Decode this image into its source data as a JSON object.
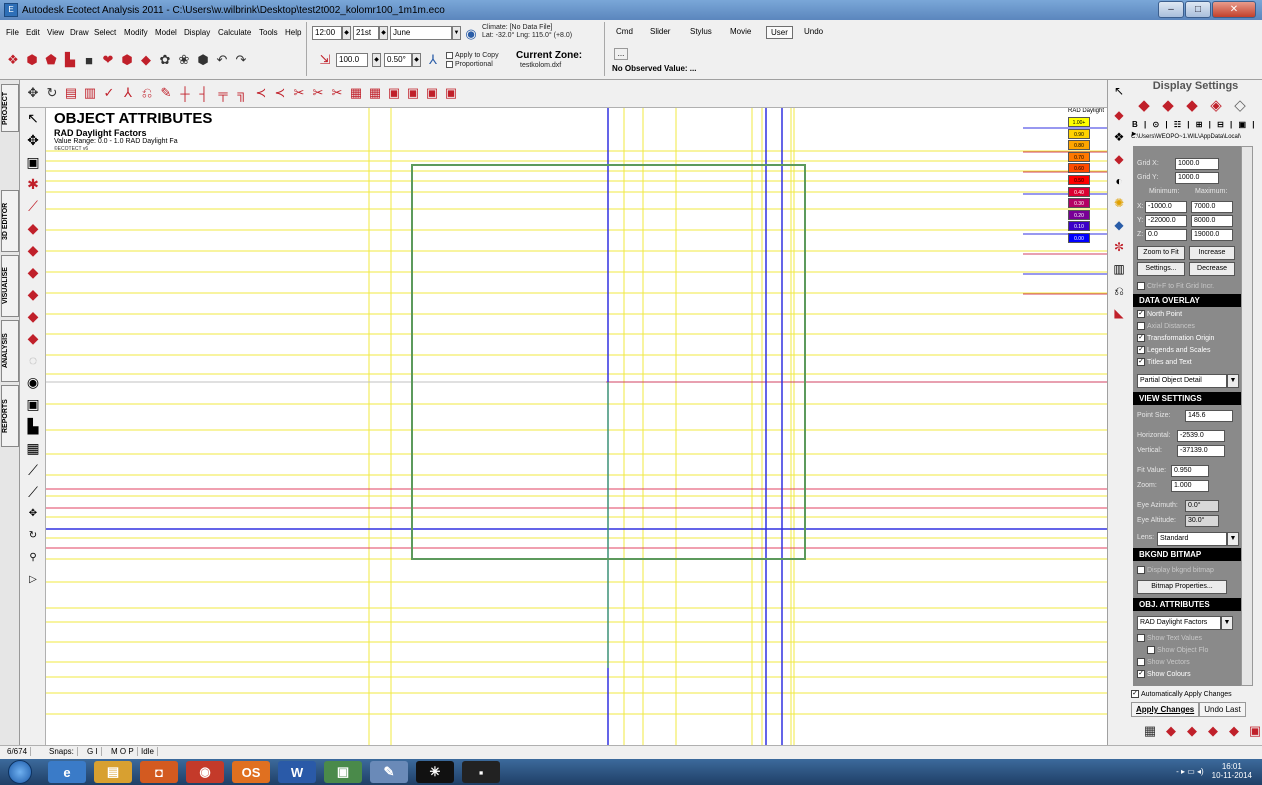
{
  "window": {
    "title": "Autodesk Ecotect Analysis 2011 - C:\\Users\\w.wilbrink\\Desktop\\test2t002_kolomr100_1m1m.eco",
    "app_icon": "E",
    "minimize": "–",
    "maximize": "□",
    "close": "✕"
  },
  "menu": {
    "items": [
      "File",
      "Edit",
      "View",
      "Draw",
      "Select",
      "Modify",
      "Model",
      "Display",
      "Calculate",
      "Tools",
      "Help"
    ]
  },
  "time_controls": {
    "time": "12:00",
    "day": "21st",
    "month": "June",
    "spin_glyph": "◆",
    "dropdown_glyph": "▼"
  },
  "climate": {
    "line1": "Climate: [No Data File]",
    "line2": "Lat: -32.0°   Lng: 115.0° (+8.0)"
  },
  "second_row": {
    "percent": "100.0",
    "step": "0.50°",
    "apply_copy": "Apply to Copy",
    "proportional": "Proportional",
    "zone_label": "Current Zone:",
    "zone_file": "testkolom.dxf"
  },
  "mode_tabs": [
    "Cmd",
    "Slider",
    "Stylus",
    "Movie",
    "User",
    "Undo"
  ],
  "mode_selected": "User",
  "observed": {
    "dots": "...",
    "value": "No Observed Value: ..."
  },
  "project_tabs": [
    "PROJECT",
    "3D EDITOR",
    "VISUALISE",
    "ANALYSIS",
    "REPORTS"
  ],
  "icons": {
    "toolbar_top_row": [
      "❖",
      "⬢",
      "⬟",
      "▙",
      "■",
      "❤",
      "⬢",
      "◆",
      "✿",
      "❀",
      "⬢",
      "↶",
      "↷"
    ],
    "toolbar_third_row": [
      "✥",
      "↻",
      "▤",
      "▥",
      "✓",
      "⅄",
      "⎌",
      "✎",
      "┼",
      "┤",
      "╤",
      "╗",
      "≺",
      "≺",
      "✂",
      "✂",
      "✂",
      "▦",
      "▦",
      "▣",
      "▣",
      "▣",
      "▣"
    ],
    "left_tools": [
      "↖",
      "✥",
      "▣",
      "✱",
      "⟋",
      "◆",
      "◆",
      "◆",
      "◆",
      "◆",
      "◆",
      "◌",
      "◉",
      "▣",
      "▙",
      "▦",
      "⟋",
      "⟋",
      "✥",
      "↻",
      "⚲",
      "▷"
    ],
    "right_tools": [
      "↖",
      "◆",
      "❖",
      "◆",
      "◐",
      "✺",
      "◆",
      "✼",
      "▥",
      "⎌",
      "◣"
    ],
    "panel_tabs": [
      "◆",
      "◆",
      "◆",
      "◈",
      "◇"
    ],
    "panel_bottom": [
      "▦",
      "◆",
      "◆",
      "◆",
      "◆",
      "▣"
    ],
    "start": "",
    "tasks": [
      "e",
      "▤",
      "◘",
      "◉",
      "OS",
      "W",
      "▣",
      "✎",
      "✳",
      "▪"
    ]
  },
  "object_attributes": {
    "title": "OBJECT ATTRIBUTES",
    "subtitle": "RAD Daylight Factors",
    "range": "Value Range: 0.0 - 1.0 RAD Daylight Fa",
    "tag": "©ECOTECT v6"
  },
  "legend": {
    "title": "RAD Daylight",
    "values": [
      "1.00+",
      "0.90",
      "0.80",
      "0.70",
      "0.60",
      "0.50",
      "0.40",
      "0.30",
      "0.20",
      "0.10",
      "0.00"
    ],
    "colors": [
      "#ffff00",
      "#ffd200",
      "#ffa500",
      "#ff7800",
      "#ff4b00",
      "#ff0000",
      "#dc0032",
      "#b40064",
      "#780096",
      "#3c00c8",
      "#0000ff"
    ]
  },
  "panel": {
    "title": "Display Settings",
    "toolbar_strip": "B | ⊙ | ☷ | ⊞ | ⊟ | ▣ | ▸",
    "path": "C:\\Users\\WEOPO~1.WIL\\AppData\\Local\\",
    "grid_x_label": "Grid X:",
    "grid_x": "1000.0",
    "grid_y_label": "Grid Y:",
    "grid_y": "1000.0",
    "min_label": "Minimum:",
    "max_label": "Maximum:",
    "x_label": "X:",
    "y_label": "Y:",
    "z_label": "Z:",
    "x_min": "-1000.0",
    "x_max": "7000.0",
    "y_min": "-22000.0",
    "y_max": "8000.0",
    "z_min": "0.0",
    "z_max": "19000.0",
    "zoom_fit": "Zoom to Fit",
    "increase": "Increase",
    "settings": "Settings...",
    "decrease": "Decrease",
    "ctrl_f": "Ctrl+F to Fit Grid Incr.",
    "data_overlay": "DATA OVERLAY",
    "overlay_checks": [
      "North Point",
      "Axial Distances",
      "Transformation Origin",
      "Legends and Scales",
      "Titles and Text"
    ],
    "overlay_checked": [
      true,
      false,
      true,
      true,
      true
    ],
    "detail_select": "Partial Object Detail",
    "view_settings": "VIEW SETTINGS",
    "point_size_label": "Point Size:",
    "point_size": "145.6",
    "horizontal_label": "Horizontal:",
    "horizontal": "-2539.0",
    "vertical_label": "Vertical:",
    "vertical": "-37139.0",
    "fit_value_label": "Fit Value:",
    "fit_value": "0.950",
    "zoom_label": "Zoom:",
    "zoom": "1.000",
    "eye_azimuth_label": "Eye Azimuth:",
    "eye_azimuth": "0.0°",
    "eye_altitude_label": "Eye Altitude:",
    "eye_altitude": "30.0°",
    "lens_label": "Lens:",
    "lens": "Standard",
    "bkgnd_bitmap": "BKGND BITMAP",
    "display_bitmap": "Display bkgnd bitmap",
    "bitmap_props": "Bitmap Properties...",
    "obj_attributes": "OBJ. ATTRIBUTES",
    "attr_select": "RAD Daylight Factors",
    "attr_checks": [
      "Show Text Values",
      "Show Object Flo",
      "Show Vectors",
      "Show Colours"
    ],
    "attr_checked": [
      false,
      false,
      false,
      true
    ],
    "auto_apply": "Automatically Apply Changes",
    "apply_changes": "Apply Changes",
    "undo_last": "Undo Last"
  },
  "status": {
    "count": "6/674",
    "snaps": "Snaps:",
    "snap_flags": "G I",
    "mode": "M O P",
    "state": "Idle"
  },
  "tray": {
    "icons": "- ▸ ▭ ◂)",
    "time": "16:01",
    "date": "10-11-2014"
  }
}
